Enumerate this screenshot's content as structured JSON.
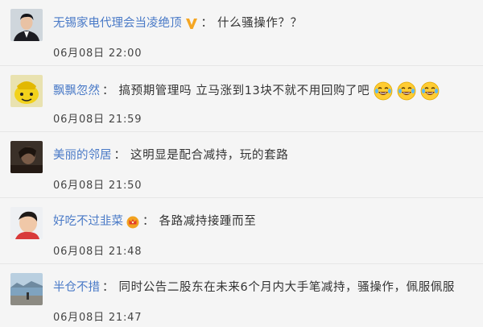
{
  "comments": [
    {
      "username": "无锡家电代理会当凌绝顶",
      "separator": "：",
      "text": "什么骚操作？？",
      "time": "06月08日 22:00",
      "avatar_icon": "avatar-man-suit",
      "badge_icon": "verified-v-icon"
    },
    {
      "username": "飘飘忽然",
      "separator": "：",
      "text": "搞预期管理吗 立马涨到13块不就不用回购了吧",
      "time": "06月08日 21:59",
      "avatar_icon": "avatar-yellow-cartoon",
      "emoji_icon": "laughing-tears-emoji",
      "emoji_count": 3
    },
    {
      "username": "美丽的邻居",
      "separator": "：",
      "text": "这明显是配合减持，玩的套路",
      "time": "06月08日 21:50",
      "avatar_icon": "avatar-dark-photo"
    },
    {
      "username": "好吃不过韭菜",
      "separator": "：",
      "text": "各路减持接踵而至",
      "time": "06月08日 21:48",
      "avatar_icon": "avatar-child-photo",
      "badge_icon": "crown-badge-icon"
    },
    {
      "username": "半仓不措",
      "separator": "：",
      "text": "同时公告二股东在未来6个月内大手笔减持，骚操作，佩服佩服",
      "time": "06月08日 21:47",
      "avatar_icon": "avatar-seaside-photo"
    }
  ],
  "colors": {
    "username": "#4a7ac7",
    "text": "#333333",
    "background": "#f5f5f5",
    "divider": "#e6e6e6",
    "verified_badge": "#f5a623"
  }
}
